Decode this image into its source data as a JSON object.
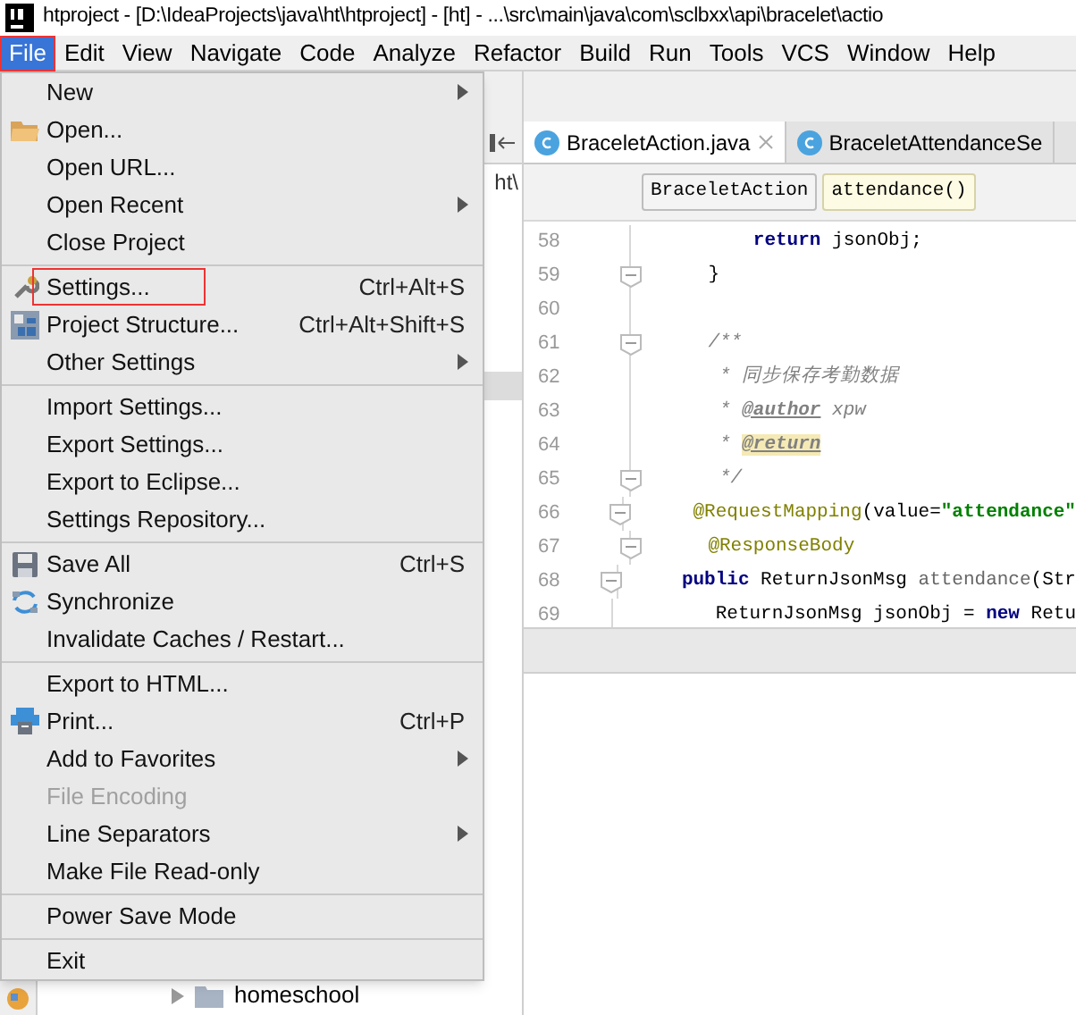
{
  "window": {
    "title": "htproject - [D:\\IdeaProjects\\java\\ht\\htproject] - [ht] - ...\\src\\main\\java\\com\\sclbxx\\api\\bracelet\\actio"
  },
  "menu_bar": [
    {
      "label": "File",
      "selected": true,
      "highlighted": true
    },
    {
      "label": "Edit",
      "selected": false,
      "highlighted": false
    },
    {
      "label": "View",
      "selected": false,
      "highlighted": false
    },
    {
      "label": "Navigate",
      "selected": false,
      "highlighted": false
    },
    {
      "label": "Code",
      "selected": false,
      "highlighted": false
    },
    {
      "label": "Analyze",
      "selected": false,
      "highlighted": false
    },
    {
      "label": "Refactor",
      "selected": false,
      "highlighted": false
    },
    {
      "label": "Build",
      "selected": false,
      "highlighted": false
    },
    {
      "label": "Run",
      "selected": false,
      "highlighted": false
    },
    {
      "label": "Tools",
      "selected": false,
      "highlighted": false
    },
    {
      "label": "VCS",
      "selected": false,
      "highlighted": false
    },
    {
      "label": "Window",
      "selected": false,
      "highlighted": false
    },
    {
      "label": "Help",
      "selected": false,
      "highlighted": false
    }
  ],
  "file_menu": [
    {
      "kind": "item",
      "label": "New",
      "submenu": true,
      "disabled": false,
      "highlighted": false
    },
    {
      "kind": "item",
      "label": "Open...",
      "submenu": false,
      "disabled": false,
      "highlighted": false
    },
    {
      "kind": "item",
      "label": "Open URL...",
      "submenu": false,
      "disabled": false,
      "highlighted": false
    },
    {
      "kind": "item",
      "label": "Open Recent",
      "submenu": true,
      "disabled": false,
      "highlighted": false
    },
    {
      "kind": "item",
      "label": "Close Project",
      "submenu": false,
      "disabled": false,
      "highlighted": false
    },
    {
      "kind": "separator"
    },
    {
      "kind": "item",
      "label": "Settings...",
      "shortcut": "Ctrl+Alt+S",
      "submenu": false,
      "disabled": false,
      "highlighted": true
    },
    {
      "kind": "item",
      "label": "Project Structure...",
      "shortcut": "Ctrl+Alt+Shift+S",
      "submenu": false,
      "disabled": false,
      "highlighted": false
    },
    {
      "kind": "item",
      "label": "Other Settings",
      "submenu": true,
      "disabled": false,
      "highlighted": false
    },
    {
      "kind": "separator"
    },
    {
      "kind": "item",
      "label": "Import Settings...",
      "submenu": false,
      "disabled": false,
      "highlighted": false
    },
    {
      "kind": "item",
      "label": "Export Settings...",
      "submenu": false,
      "disabled": false,
      "highlighted": false
    },
    {
      "kind": "item",
      "label": "Export to Eclipse...",
      "submenu": false,
      "disabled": false,
      "highlighted": false
    },
    {
      "kind": "item",
      "label": "Settings Repository...",
      "submenu": false,
      "disabled": false,
      "highlighted": false
    },
    {
      "kind": "separator"
    },
    {
      "kind": "item",
      "label": "Save All",
      "shortcut": "Ctrl+S",
      "submenu": false,
      "disabled": false,
      "highlighted": false
    },
    {
      "kind": "item",
      "label": "Synchronize",
      "submenu": false,
      "disabled": false,
      "highlighted": false
    },
    {
      "kind": "item",
      "label": "Invalidate Caches / Restart...",
      "submenu": false,
      "disabled": false,
      "highlighted": false
    },
    {
      "kind": "separator"
    },
    {
      "kind": "item",
      "label": "Export to HTML...",
      "submenu": false,
      "disabled": false,
      "highlighted": false
    },
    {
      "kind": "item",
      "label": "Print...",
      "shortcut": "Ctrl+P",
      "submenu": false,
      "disabled": false,
      "highlighted": false
    },
    {
      "kind": "item",
      "label": "Add to Favorites",
      "submenu": true,
      "disabled": false,
      "highlighted": false
    },
    {
      "kind": "item",
      "label": "File Encoding",
      "submenu": false,
      "disabled": true,
      "highlighted": false
    },
    {
      "kind": "item",
      "label": "Line Separators",
      "submenu": true,
      "disabled": false,
      "highlighted": false
    },
    {
      "kind": "item",
      "label": "Make File Read-only",
      "submenu": false,
      "disabled": false,
      "highlighted": false
    },
    {
      "kind": "separator"
    },
    {
      "kind": "item",
      "label": "Power Save Mode",
      "submenu": false,
      "disabled": false,
      "highlighted": false
    },
    {
      "kind": "separator"
    },
    {
      "kind": "item",
      "label": "Exit",
      "submenu": false,
      "disabled": false,
      "highlighted": false
    }
  ],
  "project_panel": {
    "path": "ht\\",
    "tree_item": "homeschool"
  },
  "editor_tabs": [
    {
      "label": "BraceletAction.java",
      "selected": true
    },
    {
      "label": "BraceletAttendanceSe",
      "selected": false
    }
  ],
  "breadcrumbs": [
    {
      "label": "BraceletAction",
      "selected": false
    },
    {
      "label": "attendance()",
      "selected": true
    }
  ],
  "code_lines": [
    {
      "number": "58",
      "fold": false,
      "tokens": [
        {
          "kind": "keyword",
          "text": "        return"
        },
        {
          "kind": "plain",
          "text": " jsonObj;"
        }
      ]
    },
    {
      "number": "59",
      "fold": true,
      "tokens": [
        {
          "kind": "plain",
          "text": "    }"
        }
      ]
    },
    {
      "number": "60",
      "fold": false
    },
    {
      "number": "61",
      "fold": true,
      "tokens": [
        {
          "kind": "comment",
          "text": "    /**"
        }
      ]
    },
    {
      "number": "62",
      "fold": false,
      "tokens": [
        {
          "kind": "comment",
          "text": "     * 同步保存考勤数据"
        }
      ]
    },
    {
      "number": "63",
      "fold": false,
      "tokens": [
        {
          "kind": "comment",
          "text": "     * "
        },
        {
          "kind": "doctag",
          "text": "@author"
        },
        {
          "kind": "comment",
          "text": " xpw"
        }
      ]
    },
    {
      "number": "64",
      "fold": false,
      "tokens": [
        {
          "kind": "comment",
          "text": "     * "
        },
        {
          "kind": "doctag_marked",
          "text": "@return"
        }
      ]
    },
    {
      "number": "65",
      "fold": true,
      "tokens": [
        {
          "kind": "comment",
          "text": "     */"
        }
      ]
    },
    {
      "number": "66",
      "fold": true,
      "tokens": [
        {
          "kind": "annotation",
          "text": "    @RequestMapping"
        },
        {
          "kind": "plain",
          "text": "(value="
        },
        {
          "kind": "string",
          "text": "\"attendance\""
        }
      ]
    },
    {
      "number": "67",
      "fold": true,
      "tokens": [
        {
          "kind": "annotation",
          "text": "    @ResponseBody"
        }
      ]
    },
    {
      "number": "68",
      "fold": true,
      "tokens": [
        {
          "kind": "keyword",
          "text": "    public"
        },
        {
          "kind": "plain",
          "text": " ReturnJsonMsg "
        },
        {
          "kind": "method",
          "text": "attendance"
        },
        {
          "kind": "plain",
          "text": "(Str"
        }
      ]
    },
    {
      "number": "69",
      "fold": false,
      "tokens": [
        {
          "kind": "plain",
          "text": "        ReturnJsonMsg jsonObj = "
        },
        {
          "kind": "keyword",
          "text": "new"
        },
        {
          "kind": "plain",
          "text": " Retu"
        }
      ]
    }
  ]
}
